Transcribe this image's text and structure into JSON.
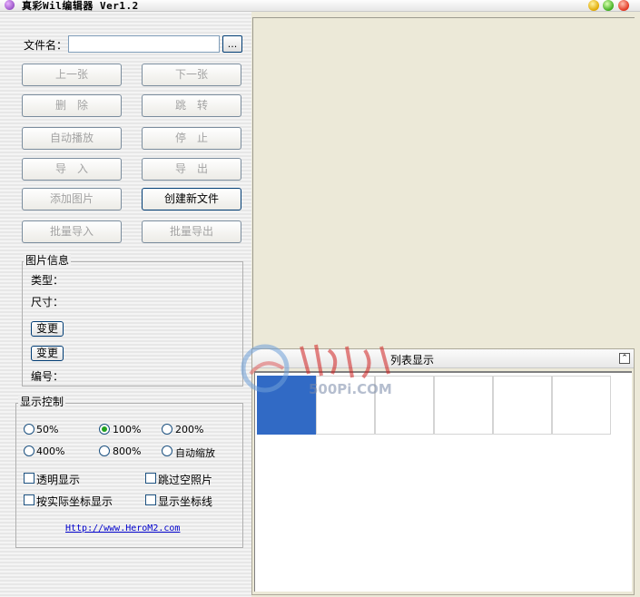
{
  "window": {
    "title": "真彩Wil编辑器 Ver1.2"
  },
  "file": {
    "label": "文件名：",
    "value": "",
    "browse": "..."
  },
  "buttons": {
    "prev": "上一张",
    "next": "下一张",
    "delete": "删　除",
    "jump": "跳　转",
    "autoplay": "自动播放",
    "stop": "停　止",
    "import": "导　入",
    "export": "导　出",
    "add_image": "添加图片",
    "create_file": "创建新文件",
    "batch_import": "批量导入",
    "batch_export": "批量导出"
  },
  "image_info": {
    "legend": "图片信息",
    "type_label": "类型：",
    "size_label": "尺寸：",
    "change1": "变更",
    "change2": "变更",
    "number_label": "编号："
  },
  "display": {
    "legend": "显示控制",
    "zoom": [
      "50%",
      "100%",
      "200%",
      "400%",
      "800%",
      "自动缩放"
    ],
    "zoom_selected": "100%",
    "check_transparent": "透明显示",
    "check_skip_empty": "跳过空照片",
    "check_actual_coords": "按实际坐标显示",
    "check_show_axes": "显示坐标线",
    "link": "Http://www.HeroM2.com"
  },
  "list": {
    "title": "列表显示",
    "cell_count": 6,
    "selected_index": 0
  },
  "watermark": {
    "text": "500Pi.COM"
  },
  "colors": {
    "selection": "#316ac5",
    "link": "#0000cc",
    "radio_dot": "#21a121"
  }
}
